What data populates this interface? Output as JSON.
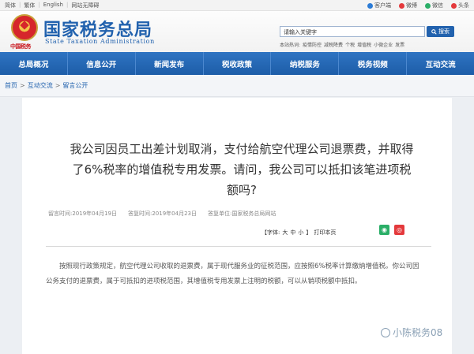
{
  "topbar": {
    "languages": [
      "简体",
      "繁体",
      "English",
      "网站无障碍"
    ],
    "social": [
      {
        "label": "客户端",
        "color": "#2b7bd6"
      },
      {
        "label": "微博",
        "color": "#e4393c"
      },
      {
        "label": "微信",
        "color": "#2aae67"
      },
      {
        "label": "头条",
        "color": "#e4393c"
      }
    ]
  },
  "header": {
    "seal_text": "中国税务",
    "title": "国家税务总局",
    "subtitle": "State Taxation Administration",
    "search_placeholder": "请输入关键字",
    "search_button": "搜索",
    "hot_label": "本站热词:",
    "hot_terms": [
      "疫情防控",
      "减税降费",
      "个税",
      "增值税",
      "小微企业",
      "发票"
    ]
  },
  "nav": {
    "items": [
      "总局概况",
      "信息公开",
      "新闻发布",
      "税收政策",
      "纳税服务",
      "税务视频",
      "互动交流"
    ]
  },
  "breadcrumb": {
    "items": [
      "首页",
      "互动交流",
      "留言公开"
    ]
  },
  "article": {
    "question": "我公司因员工出差计划取消，支付给航空代理公司退票费，并取得了6%税率的增值税专用发票。请问，我公司可以抵扣该笔进项税额吗?",
    "meta": {
      "posted": "留言时间:2019年04月19日",
      "answered": "答复时间:2019年04月23日",
      "source": "答复单位:国家税务总局网站"
    },
    "font_label": "【字体:",
    "font_sizes": [
      "大",
      "中",
      "小"
    ],
    "font_close": "】",
    "print_label": "打印本页",
    "answer": "按照现行政策规定，航空代理公司收取的退票费，属于现代服务业的征税范围，应按照6%税率计算缴纳增值税。你公司因公务支付的退票费，属于可抵扣的进项税范围，其增值税专用发票上注明的税额，可以从销项税额中抵扣。"
  },
  "watermark": "小陈税务08"
}
